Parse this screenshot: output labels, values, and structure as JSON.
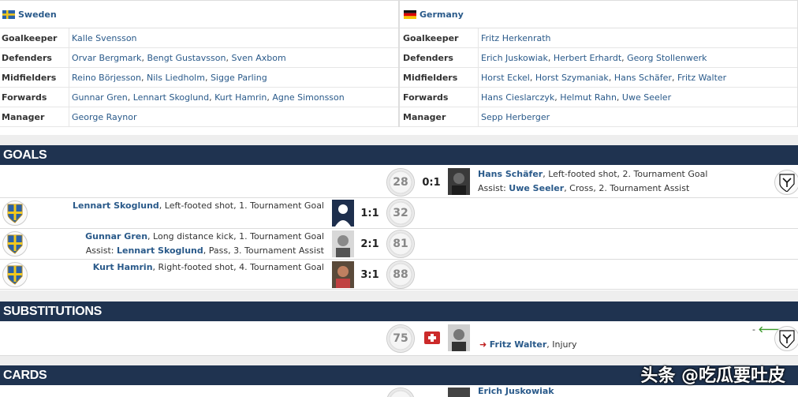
{
  "lineups": {
    "home": {
      "team": "Sweden",
      "rows": [
        {
          "role": "Goalkeeper",
          "players": [
            "Kalle Svensson"
          ]
        },
        {
          "role": "Defenders",
          "players": [
            "Orvar Bergmark",
            "Bengt Gustavsson",
            "Sven Axbom"
          ]
        },
        {
          "role": "Midfielders",
          "players": [
            "Reino Börjesson",
            "Nils Liedholm",
            "Sigge Parling"
          ]
        },
        {
          "role": "Forwards",
          "players": [
            "Gunnar Gren",
            "Lennart Skoglund",
            "Kurt Hamrin",
            "Agne Simonsson"
          ]
        },
        {
          "role": "Manager",
          "players": [
            "George Raynor"
          ]
        }
      ]
    },
    "away": {
      "team": "Germany",
      "rows": [
        {
          "role": "Goalkeeper",
          "players": [
            "Fritz Herkenrath"
          ]
        },
        {
          "role": "Defenders",
          "players": [
            "Erich Juskowiak",
            "Herbert Erhardt",
            "Georg Stollenwerk"
          ]
        },
        {
          "role": "Midfielders",
          "players": [
            "Horst Eckel",
            "Horst Szymaniak",
            "Hans Schäfer",
            "Fritz Walter"
          ]
        },
        {
          "role": "Forwards",
          "players": [
            "Hans Cieslarczyk",
            "Helmut Rahn",
            "Uwe Seeler"
          ]
        },
        {
          "role": "Manager",
          "players": [
            "Sepp Herberger"
          ]
        }
      ]
    }
  },
  "sections": {
    "goals": "GOALS",
    "substitutions": "SUBSTITUTIONS",
    "cards": "CARDS"
  },
  "goals": [
    {
      "side": "away",
      "minute": "28",
      "score": "0:1",
      "scorer": "Hans Schäfer",
      "detail": ", Left-footed shot, 2. Tournament Goal",
      "assist_label": "Assist: ",
      "assist": "Uwe Seeler",
      "assist_detail": ", Cross, 2. Tournament Assist"
    },
    {
      "side": "home",
      "minute": "32",
      "score": "1:1",
      "scorer": "Lennart Skoglund",
      "detail": ", Left-footed shot, 1. Tournament Goal"
    },
    {
      "side": "home",
      "minute": "81",
      "score": "2:1",
      "scorer": "Gunnar Gren",
      "detail": ", Long distance kick, 1. Tournament Goal",
      "assist_label": "Assist: ",
      "assist": "Lennart Skoglund",
      "assist_detail": ", Pass, 3. Tournament Assist"
    },
    {
      "side": "home",
      "minute": "88",
      "score": "3:1",
      "scorer": "Kurt Hamrin",
      "detail": ", Right-footed shot, 4. Tournament Goal"
    }
  ],
  "substitution": {
    "minute": "75",
    "player": "Fritz Walter",
    "reason": ", Injury",
    "in_placeholder": "-"
  },
  "cards": {
    "player": "Erich Juskowiak"
  },
  "watermark": "头条 @吃瓜要吐皮",
  "colors": {
    "header_bg": "#1f3350",
    "link": "#2a5a8a"
  }
}
